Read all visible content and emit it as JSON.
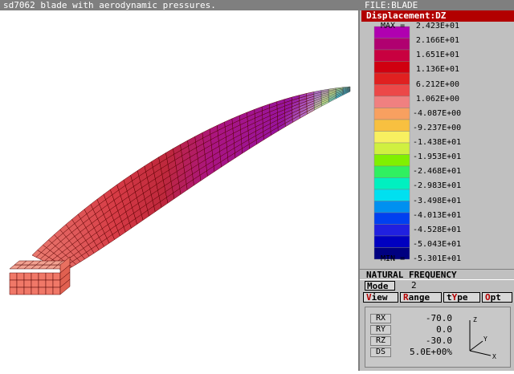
{
  "window": {
    "title": "sd7062 blade with aerodynamic pressures."
  },
  "panel": {
    "file_label": "FILE:BLADE",
    "result_title": "Displacement:DZ",
    "legend": {
      "max_label": "MAX =",
      "min_label": "MIN =",
      "values": [
        "2.423E+01",
        "2.166E+01",
        "1.651E+01",
        "1.136E+01",
        "6.212E+00",
        "1.062E+00",
        "-4.087E+00",
        "-9.237E+00",
        "-1.438E+01",
        "-1.953E+01",
        "-2.468E+01",
        "-2.983E+01",
        "-3.498E+01",
        "-4.013E+01",
        "-4.528E+01",
        "-5.043E+01",
        "-5.301E+01"
      ],
      "colors": [
        "#b000b0",
        "#b00070",
        "#c80040",
        "#d00010",
        "#e02020",
        "#ec4848",
        "#f08080",
        "#f8a060",
        "#f8c040",
        "#f8f060",
        "#d0f040",
        "#80f000",
        "#30f060",
        "#00f0c0",
        "#00e0f0",
        "#0090f0",
        "#0040f0",
        "#2020e0",
        "#0000c0",
        "#000080"
      ]
    },
    "natural_frequency_label": "NATURAL FREQUENCY",
    "mode": {
      "label": "Mode",
      "value": "2"
    },
    "menu": [
      {
        "hotkey": "V",
        "rest": "iew"
      },
      {
        "hotkey": "R",
        "rest": "ange"
      },
      {
        "pre": "t",
        "hotkey": "Y",
        "rest": "pe"
      },
      {
        "hotkey": "O",
        "rest": "pt"
      }
    ],
    "view": {
      "rx": {
        "key": "RX",
        "value": "-70.0"
      },
      "ry": {
        "key": "RY",
        "value": "0.0"
      },
      "rz": {
        "key": "RZ",
        "value": "-30.0"
      },
      "ds": {
        "key": "DS",
        "value": "5.0E+00%"
      },
      "axes": {
        "z": "Z",
        "y": "Y",
        "x": "X"
      }
    }
  }
}
